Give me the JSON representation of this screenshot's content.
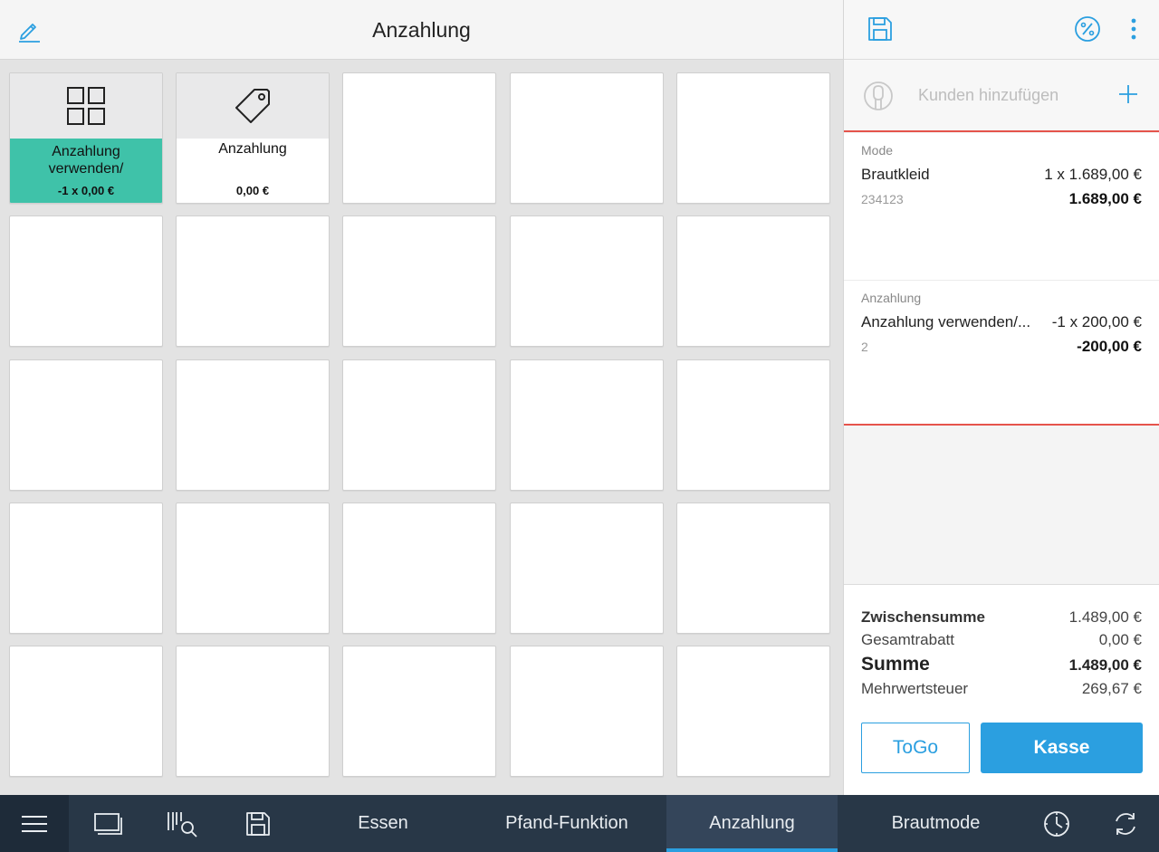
{
  "header": {
    "title": "Anzahlung"
  },
  "tiles": [
    {
      "name": "Anzahlung verwenden/",
      "price": "-1 x 0,00 €",
      "icon": "grid-icon",
      "style": "teal"
    },
    {
      "name": "Anzahlung",
      "price": "0,00 €",
      "icon": "price-tag-icon",
      "style": "plain"
    }
  ],
  "right_panel": {
    "customer_placeholder": "Kunden hinzufügen",
    "cart_items": [
      {
        "category": "Mode",
        "name": "Brautkleid",
        "qty_price": "1 x 1.689,00 €",
        "code": "234123",
        "total": "1.689,00 €"
      },
      {
        "category": "Anzahlung",
        "name": "Anzahlung verwenden/...",
        "qty_price": "-1 x 200,00 €",
        "code": "2",
        "total": "-200,00 €"
      }
    ],
    "totals": {
      "subtotal_label": "Zwischensumme",
      "subtotal_value": "1.489,00 €",
      "discount_label": "Gesamtrabatt",
      "discount_value": "0,00 €",
      "sum_label": "Summe",
      "sum_value": "1.489,00 €",
      "vat_label": "Mehrwertsteuer",
      "vat_value": "269,67 €"
    },
    "togo_label": "ToGo",
    "checkout_label": "Kasse"
  },
  "bottom_nav": {
    "tabs": [
      "Essen",
      "Pfand-Funktion",
      "Anzahlung",
      "Brautmode"
    ],
    "active_tab": "Anzahlung"
  },
  "colors": {
    "accent": "#2b9fe0",
    "teal": "#3fc2a9",
    "cart_border": "#e5534b",
    "nav_bg": "#283747"
  }
}
